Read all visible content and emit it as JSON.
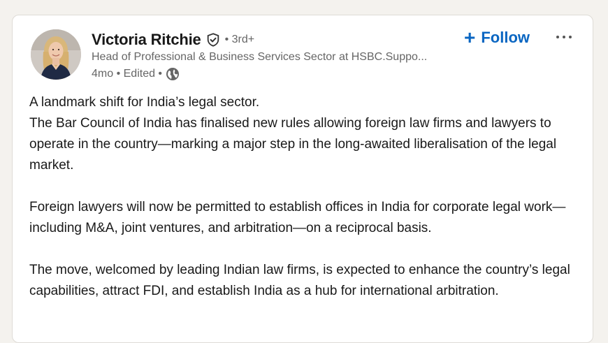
{
  "post": {
    "author": {
      "name": "Victoria Ritchie",
      "degree": "• 3rd+",
      "headline": "Head of Professional & Business Services Sector at HSBC.Suppo...",
      "meta": "4mo • Edited •",
      "verified_icon": "verified-shield-icon",
      "visibility_icon": "globe-icon"
    },
    "follow_label": "Follow",
    "more_icon": "ellipsis-icon",
    "paragraphs": [
      [
        "A landmark shift for India’s legal sector.",
        "The Bar Council of India has finalised new rules allowing foreign law firms and lawyers to operate in the country—marking a major step in the long-awaited liberalisation of the legal market."
      ],
      [
        "Foreign lawyers will now be permitted to establish offices in India for corporate legal work—including M&A, joint ventures, and arbitration—on a reciprocal basis."
      ],
      [
        "The move, welcomed by leading Indian law firms, is expected to enhance the country’s legal capabilities, attract FDI, and establish India as a hub for international arbitration."
      ]
    ]
  },
  "colors": {
    "accent": "#0a66c2",
    "text_primary": "#191919",
    "text_secondary": "#666666",
    "page_bg": "#f4f2ee"
  }
}
